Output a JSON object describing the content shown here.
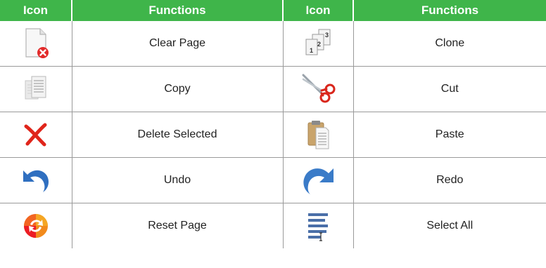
{
  "header": {
    "icon1": "Icon",
    "functions1": "Functions",
    "icon2": "Icon",
    "functions2": "Functions"
  },
  "rows": [
    {
      "left": {
        "icon": "clear-page-icon",
        "label": "Clear Page"
      },
      "right": {
        "icon": "clone-icon",
        "label": "Clone",
        "numbers": [
          "1",
          "2",
          "3"
        ]
      }
    },
    {
      "left": {
        "icon": "copy-icon",
        "label": "Copy"
      },
      "right": {
        "icon": "cut-icon",
        "label": "Cut"
      }
    },
    {
      "left": {
        "icon": "delete-selected-icon",
        "label": "Delete Selected"
      },
      "right": {
        "icon": "paste-icon",
        "label": "Paste"
      }
    },
    {
      "left": {
        "icon": "undo-icon",
        "label": "Undo"
      },
      "right": {
        "icon": "redo-icon",
        "label": "Redo"
      }
    },
    {
      "left": {
        "icon": "reset-page-icon",
        "label": "Reset Page"
      },
      "right": {
        "icon": "select-all-icon",
        "label": "Select All"
      }
    }
  ],
  "colors": {
    "header_bg": "#3fb54a",
    "header_text": "#ffffff",
    "border": "#9a9a9a",
    "delete_red": "#e0251b",
    "undo_blue": "#2f6fc0"
  }
}
